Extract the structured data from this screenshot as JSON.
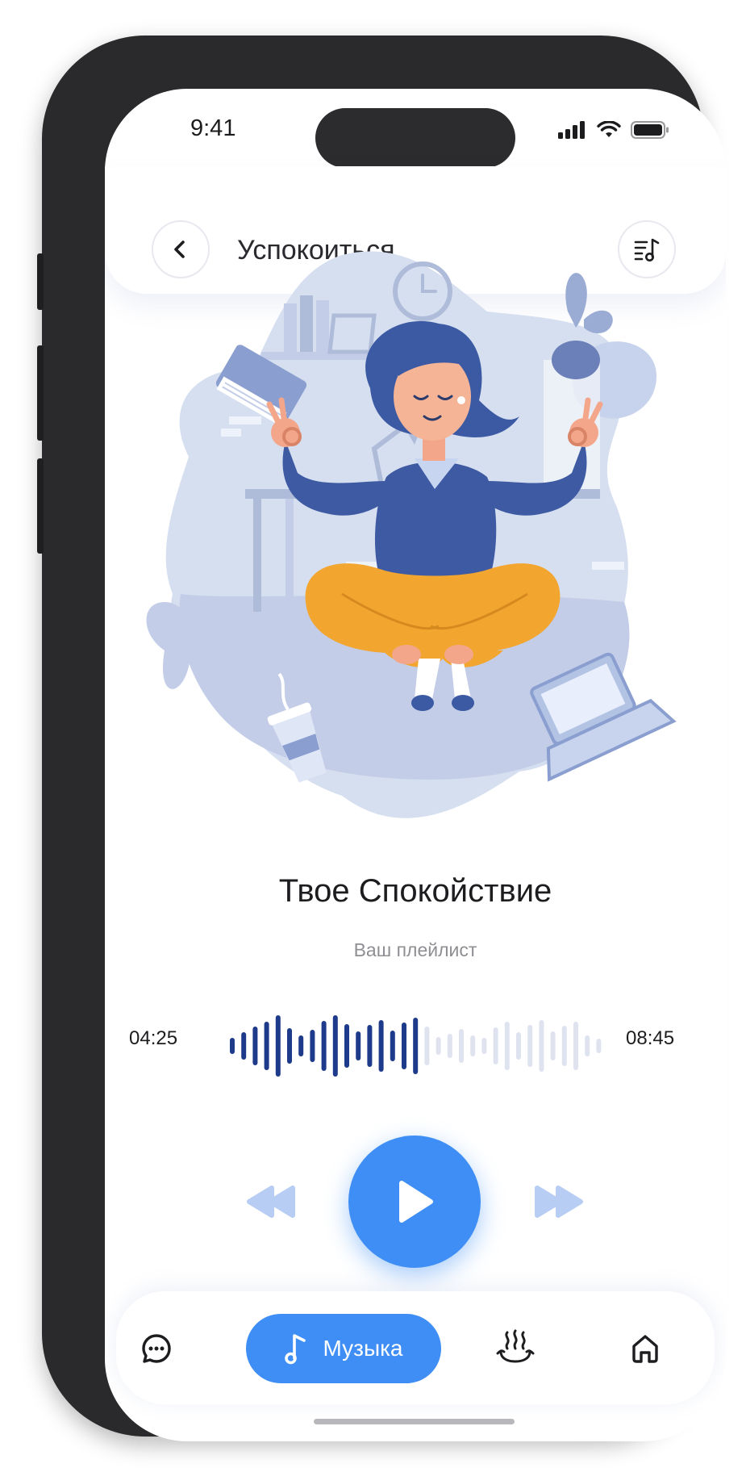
{
  "status_bar": {
    "time": "9:41"
  },
  "header": {
    "title": "Успокоиться",
    "back_icon": "chevron-left-icon",
    "playlist_icon": "playlist-music-icon"
  },
  "track": {
    "title": "Твое Спокойствие",
    "subtitle": "Ваш плейлист",
    "elapsed": "04:25",
    "duration": "08:45",
    "progress": 0.51
  },
  "controls": {
    "rewind_icon": "rewind-icon",
    "play_icon": "play-icon",
    "forward_icon": "fast-forward-icon"
  },
  "nav": {
    "items": [
      {
        "id": "chat",
        "icon": "chat-icon"
      },
      {
        "id": "music",
        "icon": "music-note-icon",
        "label": "Музыка",
        "active": true
      },
      {
        "id": "steam",
        "icon": "steam-icon"
      },
      {
        "id": "home",
        "icon": "home-icon"
      }
    ]
  },
  "colors": {
    "accent": "#3f8ef5",
    "wave_played": "#1e3a8a",
    "wave_remaining": "#dfe3f0",
    "controls_light": "#b7cdf3",
    "illustration_bg": "#d6dff0"
  }
}
